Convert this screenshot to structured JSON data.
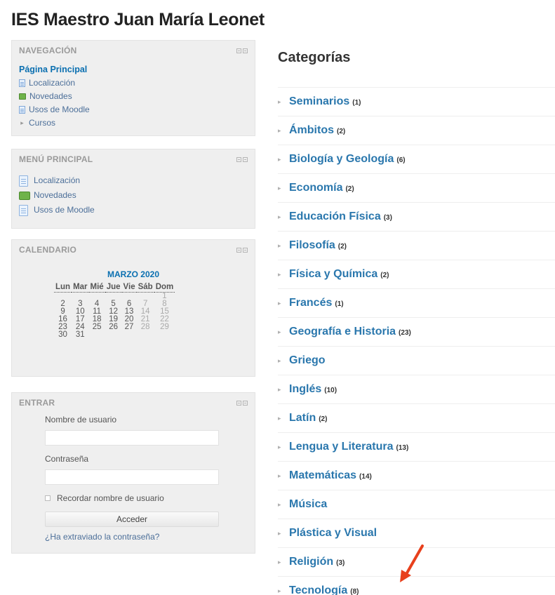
{
  "site": {
    "title": "IES Maestro Juan María Leonet"
  },
  "navigation": {
    "title": "NAVEGACIÓN",
    "home": "Página Principal",
    "items": [
      {
        "label": "Localización",
        "icon": "page-icon"
      },
      {
        "label": "Novedades",
        "icon": "forum-icon"
      },
      {
        "label": "Usos de Moodle",
        "icon": "page-icon"
      },
      {
        "label": "Cursos",
        "icon": "collapsed-arrow-icon"
      }
    ]
  },
  "main_menu": {
    "title": "MENÚ PRINCIPAL",
    "items": [
      {
        "label": "Localización",
        "icon": "page-icon"
      },
      {
        "label": "Novedades",
        "icon": "forum-icon"
      },
      {
        "label": "Usos de Moodle",
        "icon": "page-icon"
      }
    ]
  },
  "calendar": {
    "title": "CALENDARIO",
    "month": "MARZO 2020",
    "weekdays": [
      "Lun",
      "Mar",
      "Mié",
      "Jue",
      "Vie",
      "Sáb",
      "Dom"
    ],
    "weeks": [
      [
        "",
        "",
        "",
        "",
        "",
        "",
        "1"
      ],
      [
        "2",
        "3",
        "4",
        "5",
        "6",
        "7",
        "8"
      ],
      [
        "9",
        "10",
        "11",
        "12",
        "13",
        "14",
        "15"
      ],
      [
        "16",
        "17",
        "18",
        "19",
        "20",
        "21",
        "22"
      ],
      [
        "23",
        "24",
        "25",
        "26",
        "27",
        "28",
        "29"
      ],
      [
        "30",
        "31",
        "",
        "",
        "",
        "",
        ""
      ]
    ]
  },
  "login": {
    "title": "ENTRAR",
    "username_label": "Nombre de usuario",
    "username_value": "",
    "password_label": "Contraseña",
    "password_value": "",
    "remember_label": "Recordar nombre de usuario",
    "submit_label": "Acceder",
    "forgot_label": "¿Ha extraviado la contraseña?"
  },
  "categories": {
    "heading": "Categorías",
    "items": [
      {
        "name": "Seminarios",
        "count": "(1)"
      },
      {
        "name": "Ámbitos",
        "count": "(2)"
      },
      {
        "name": "Biología y Geología",
        "count": "(6)"
      },
      {
        "name": "Economía",
        "count": "(2)"
      },
      {
        "name": "Educación Física",
        "count": "(3)"
      },
      {
        "name": "Filosofía",
        "count": "(2)"
      },
      {
        "name": "Física y Química",
        "count": "(2)"
      },
      {
        "name": "Francés",
        "count": "(1)"
      },
      {
        "name": "Geografía e Historia",
        "count": "(23)"
      },
      {
        "name": "Griego",
        "count": ""
      },
      {
        "name": "Inglés",
        "count": "(10)"
      },
      {
        "name": "Latín",
        "count": "(2)"
      },
      {
        "name": "Lengua y Literatura",
        "count": "(13)"
      },
      {
        "name": "Matemáticas",
        "count": "(14)"
      },
      {
        "name": "Música",
        "count": ""
      },
      {
        "name": "Plástica y Visual",
        "count": ""
      },
      {
        "name": "Religión",
        "count": "(3)"
      },
      {
        "name": "Tecnología",
        "count": "(8)"
      }
    ]
  },
  "colors": {
    "link": "#2a77ad",
    "block_bg": "#efefef",
    "annotation_arrow": "#e8401c"
  }
}
